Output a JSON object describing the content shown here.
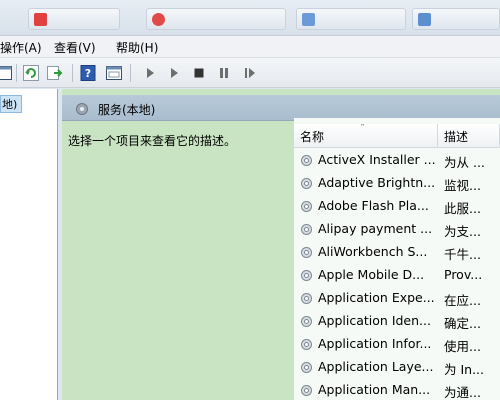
{
  "menubar": {
    "items": [
      "操作(A)",
      "查看(V)",
      "帮助(H)"
    ]
  },
  "tree": {
    "selected_label": "地)"
  },
  "main": {
    "header_title": "服务(本地)",
    "description_prompt": "选择一个项目来查看它的描述。"
  },
  "list": {
    "columns": {
      "name": "名称",
      "description": "描述"
    },
    "rows": [
      {
        "name": "ActiveX Installer ...",
        "desc": "为从 ..."
      },
      {
        "name": "Adaptive Brightn...",
        "desc": "监视..."
      },
      {
        "name": "Adobe Flash Pla...",
        "desc": "此服..."
      },
      {
        "name": "Alipay payment ...",
        "desc": "为支..."
      },
      {
        "name": "AliWorkbench S...",
        "desc": "千牛..."
      },
      {
        "name": "Apple Mobile D...",
        "desc": "Prov..."
      },
      {
        "name": "Application Expe...",
        "desc": "在应..."
      },
      {
        "name": "Application Iden...",
        "desc": "确定..."
      },
      {
        "name": "Application Infor...",
        "desc": "使用..."
      },
      {
        "name": "Application Laye...",
        "desc": "为 In..."
      },
      {
        "name": "Application Man...",
        "desc": "为通..."
      }
    ]
  },
  "colors": {
    "main_background": "#c9e4c2",
    "header_background": "#afc2d3",
    "selection": "#cde4f7"
  }
}
